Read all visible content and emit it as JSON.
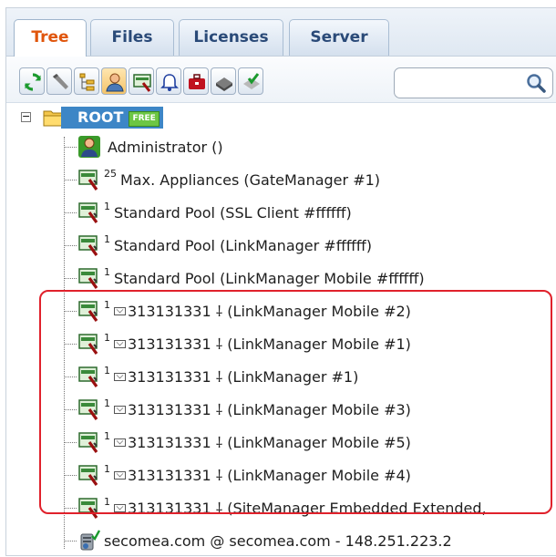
{
  "tabs": [
    {
      "label": "Tree",
      "active": true
    },
    {
      "label": "Files",
      "active": false
    },
    {
      "label": "Licenses",
      "active": false
    },
    {
      "label": "Server",
      "active": false
    }
  ],
  "toolbar": {
    "icons": [
      "refresh-icon",
      "tools-icon",
      "tree-list-icon",
      "user-icon",
      "appliance-icon",
      "bell-icon",
      "toolbox-icon",
      "hard-drive-icon",
      "approve-icon"
    ],
    "search": {
      "value": "",
      "placeholder": ""
    }
  },
  "tree": {
    "root": {
      "label": "ROOT",
      "badge": "FREE",
      "expander": "−"
    },
    "items": [
      {
        "icon": "admin-user-icon",
        "count": "",
        "text": "Administrator ()"
      },
      {
        "icon": "appliance-icon",
        "count": "25",
        "text": "Max. Appliances (GateManager #1)"
      },
      {
        "icon": "appliance-icon",
        "count": "1",
        "text": "Standard Pool (SSL Client #ffffff)"
      },
      {
        "icon": "appliance-icon",
        "count": "1",
        "text": "Standard Pool (LinkManager #ffffff)"
      },
      {
        "icon": "appliance-icon",
        "count": "1",
        "text": "Standard Pool (LinkManager Mobile #ffffff)"
      },
      {
        "icon": "appliance-icon",
        "count": "1",
        "text": "313131331 ⸸ (LinkManager Mobile #2)",
        "mail": true
      },
      {
        "icon": "appliance-icon",
        "count": "1",
        "text": "313131331 ⸸ (LinkManager Mobile #1)",
        "mail": true
      },
      {
        "icon": "appliance-icon",
        "count": "1",
        "text": "313131331 ⸸ (LinkManager #1)",
        "mail": true
      },
      {
        "icon": "appliance-icon",
        "count": "1",
        "text": "313131331 ⸸ (LinkManager Mobile #3)",
        "mail": true
      },
      {
        "icon": "appliance-icon",
        "count": "1",
        "text": "313131331 ⸸ (LinkManager Mobile #5)",
        "mail": true
      },
      {
        "icon": "appliance-icon",
        "count": "1",
        "text": "313131331 ⸸ (LinkManager Mobile #4)",
        "mail": true
      },
      {
        "icon": "appliance-icon",
        "count": "1",
        "text": "313131331 ⸸ (SiteManager Embedded Extended,",
        "mail": true
      },
      {
        "icon": "server-icon",
        "count": "",
        "text": "secomea.com @ secomea.com - 148.251.223.2"
      }
    ]
  },
  "colors": {
    "active_tab": "#e0550b",
    "root_highlight": "#3d86c6",
    "highlight_box": "#e0212b"
  }
}
